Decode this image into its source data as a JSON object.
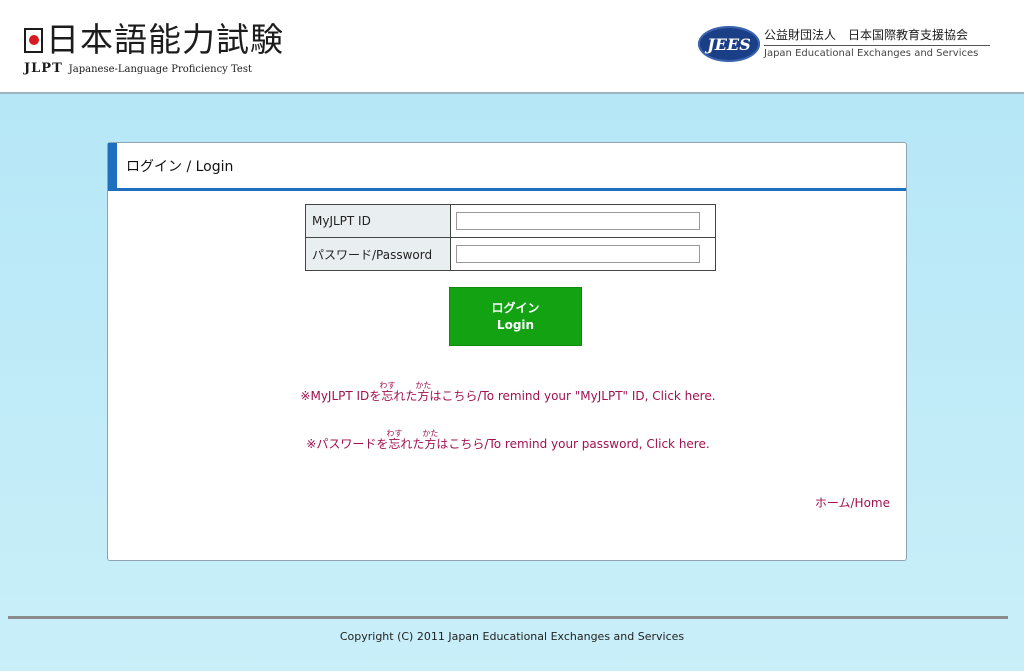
{
  "header": {
    "jlpt_title": "日本語能力試験",
    "jlpt_abbr": "JLPT",
    "jlpt_full": "Japanese-Language Proficiency Test",
    "jees_mark": "JEES",
    "jees_name_jp": "公益財団法人　日本国際教育支援協会",
    "jees_name_en": "Japan Educational Exchanges and Services"
  },
  "login": {
    "title": "ログイン / Login",
    "id_label": "MyJLPT ID",
    "id_value": "",
    "password_label": "パスワード/Password",
    "password_value": "",
    "button_jp": "ログイン",
    "button_en": "Login",
    "remind_id": {
      "prefix": "※MyJLPT IDを",
      "kanji1": "忘",
      "reading1": "わす",
      "mid": "れた",
      "kanji2": "方",
      "reading2": "かた",
      "suffix": "はこちら/To remind your \"MyJLPT\" ID, Click here."
    },
    "remind_password": {
      "prefix": "※パスワードを",
      "kanji1": "忘",
      "reading1": "わす",
      "mid": "れた",
      "kanji2": "方",
      "reading2": "かた",
      "suffix": "はこちら/To remind your password, Click here."
    },
    "home_link": "ホーム/Home"
  },
  "footer": {
    "copyright": "Copyright (C) 2011 Japan Educational Exchanges and Services"
  },
  "colors": {
    "accent_blue": "#1e6fbd",
    "button_green": "#12a212",
    "link_color": "#a0124f",
    "background": "#b6e7f7"
  }
}
